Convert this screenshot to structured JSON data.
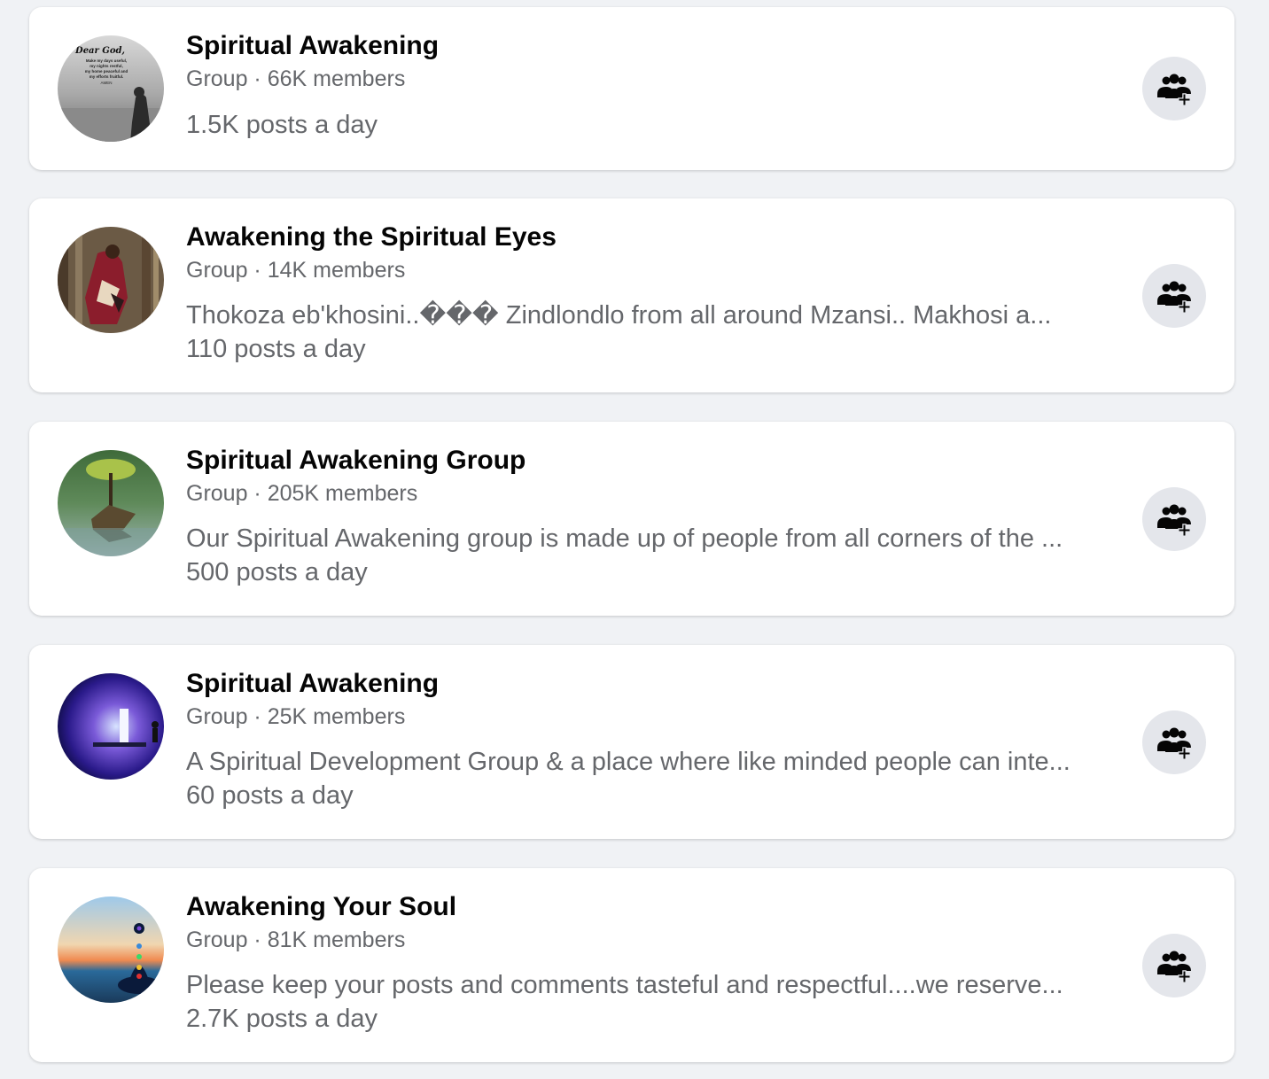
{
  "groups": [
    {
      "name": "Spiritual Awakening",
      "meta": "Group · 66K members",
      "description": "",
      "posts": "1.5K posts a day",
      "avatar_text": [
        "Dear God,",
        "Make my days useful,",
        "my nights restful,",
        "my home peaceful and",
        "my efforts fruitful.",
        "AMEN"
      ]
    },
    {
      "name": "Awakening the Spiritual Eyes",
      "meta": "Group · 14K members",
      "description": "Thokoza eb'khosini..��� Zindlondlo from all around Mzansi.. Makhosi a...",
      "posts": "110 posts a day"
    },
    {
      "name": "Spiritual Awakening Group",
      "meta": "Group · 205K members",
      "description": "Our Spiritual Awakening group is made up of people from all corners of the ...",
      "posts": "500 posts a day"
    },
    {
      "name": "Spiritual Awakening",
      "meta": "Group · 25K members",
      "description": "A Spiritual Development Group & a place where like minded people can inte...",
      "posts": "60 posts a day"
    },
    {
      "name": "Awakening Your Soul",
      "meta": "Group · 81K members",
      "description": "Please keep your posts and comments tasteful and respectful....we reserve...",
      "posts": "2.7K posts a day"
    }
  ],
  "join_icon": "group-add-icon",
  "colors": {
    "page_background": "#f0f2f5",
    "card_background": "#ffffff",
    "title_text": "#050505",
    "secondary_text": "#65676b",
    "button_background": "#e4e6eb",
    "icon": "#050505"
  }
}
